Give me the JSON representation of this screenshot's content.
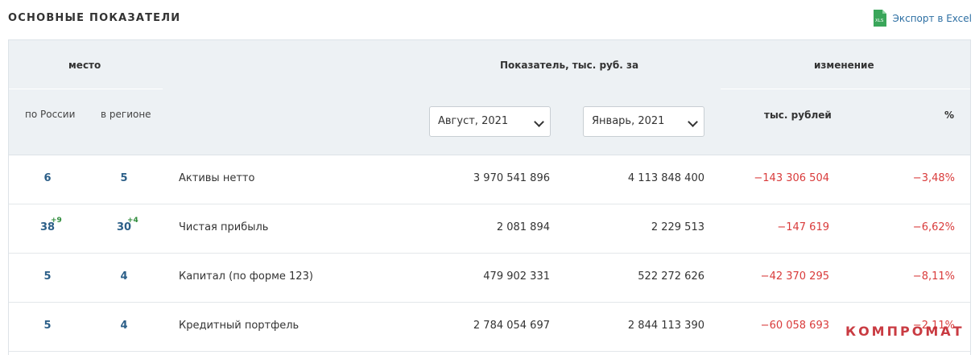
{
  "page": {
    "title": "ОСНОВНЫЕ ПОКАЗАТЕЛИ",
    "export_label": "Экспорт в Excel",
    "export_icon": "excel-file-icon",
    "export_icon_text": "XLS"
  },
  "table": {
    "header": {
      "place": "место",
      "indicator": "Показатель, тыс. руб. за",
      "change": "изменение",
      "by_russia": "по России",
      "in_region": "в регионе",
      "thousand_rub": "тыс. рублей",
      "percent": "%",
      "period1": "Август, 2021",
      "period2": "Январь, 2021"
    },
    "rows": [
      {
        "rank_russia": "6",
        "rank_russia_delta": "",
        "rank_region": "5",
        "rank_region_delta": "",
        "name": "Активы нетто",
        "value1": "3 970 541 896",
        "value2": "4 113 848 400",
        "change_abs": "−143 306 504",
        "change_pct": "−3,48%"
      },
      {
        "rank_russia": "38",
        "rank_russia_delta": "+9",
        "rank_region": "30",
        "rank_region_delta": "+4",
        "name": "Чистая прибыль",
        "value1": "2 081 894",
        "value2": "2 229 513",
        "change_abs": "−147 619",
        "change_pct": "−6,62%"
      },
      {
        "rank_russia": "5",
        "rank_russia_delta": "",
        "rank_region": "4",
        "rank_region_delta": "",
        "name": "Капитал (по форме 123)",
        "value1": "479 902 331",
        "value2": "522 272 626",
        "change_abs": "−42 370 295",
        "change_pct": "−8,11%"
      },
      {
        "rank_russia": "5",
        "rank_russia_delta": "",
        "rank_region": "4",
        "rank_region_delta": "",
        "name": "Кредитный портфель",
        "value1": "2 784 054 697",
        "value2": "2 844 113 390",
        "change_abs": "−60 058 693",
        "change_pct": "−2,11%"
      }
    ]
  },
  "watermark": "КОМПРОМАТ",
  "colors": {
    "rank": "#2c5f88",
    "delta_up": "#2e8b3a",
    "negative": "#d93b3b",
    "header_bg": "#edf1f4",
    "link": "#2d6fa3"
  }
}
